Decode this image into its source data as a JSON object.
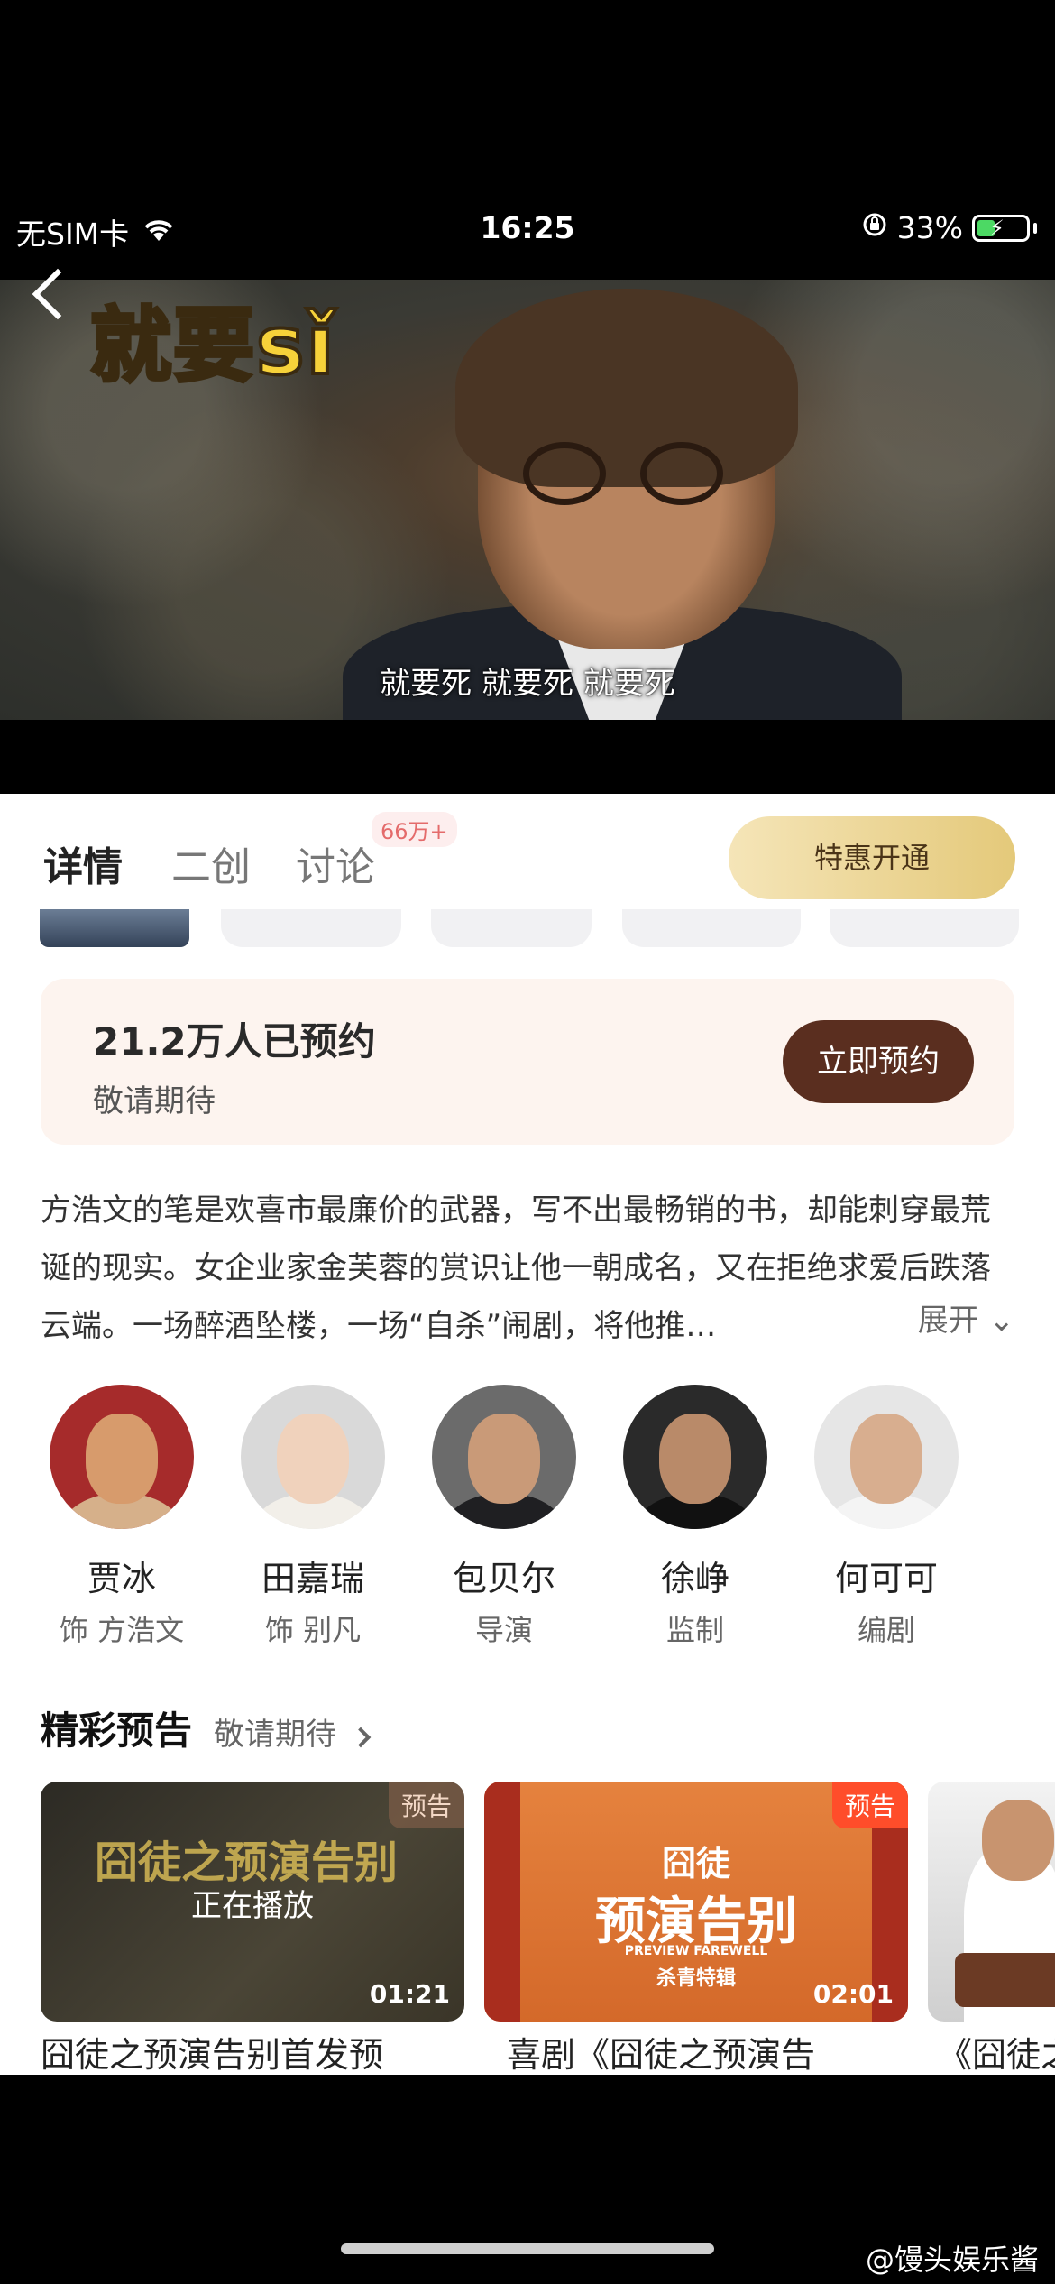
{
  "status_bar": {
    "carrier": "无SIM卡",
    "time": "16:25",
    "battery": "33%"
  },
  "video": {
    "title_overlay": "就要sǐ",
    "subtitle": "就要死 就要死 就要死"
  },
  "tabs": [
    {
      "label": "详情",
      "active": true
    },
    {
      "label": "二创",
      "active": false
    },
    {
      "label": "讨论",
      "active": false
    }
  ],
  "discussion_badge": "66万+",
  "vip_button": "特惠开通",
  "reservation": {
    "count_text": "21.2万人已预约",
    "sub_text": "敬请期待",
    "button": "立即预约"
  },
  "description": {
    "text": "方浩文的笔是欢喜市最廉价的武器，写不出最畅销的书，却能刺穿最荒诞的现实。女企业家金芙蓉的赏识让他一朝成名，又在拒绝求爱后跌落云端。一场醉酒坠楼，一场“自杀”闹剧，将他推…",
    "expand": "展开"
  },
  "cast": [
    {
      "name": "贾冰",
      "role": "饰 方浩文"
    },
    {
      "name": "田嘉瑞",
      "role": "饰 别凡"
    },
    {
      "name": "包贝尔",
      "role": "导演"
    },
    {
      "name": "徐峥",
      "role": "监制"
    },
    {
      "name": "何可可",
      "role": "编剧"
    }
  ],
  "trailers_section": {
    "title": "精彩预告",
    "subtitle": "敬请期待"
  },
  "trailers": [
    {
      "badge": "预告",
      "now_playing": "正在播放",
      "duration": "01:21",
      "caption": "囧徒之预演告别首发预",
      "art": "囧徒之预演告别"
    },
    {
      "badge": "预告",
      "duration": "02:01",
      "caption": "喜剧《囧徒之预演告",
      "art_title": "囧徒",
      "art_main": "预演告别",
      "art_en": "PREVIEW FAREWELL",
      "art_sub": "杀青特辑"
    },
    {
      "caption": "《囧徒之"
    }
  ],
  "watermark": "@馒头娱乐酱",
  "colors": {
    "vip_gold": "#e4c97a",
    "reserve_brown": "#5a2e1f",
    "reserve_bg": "#fdf4ef",
    "badge_red": "#e46b6b"
  }
}
